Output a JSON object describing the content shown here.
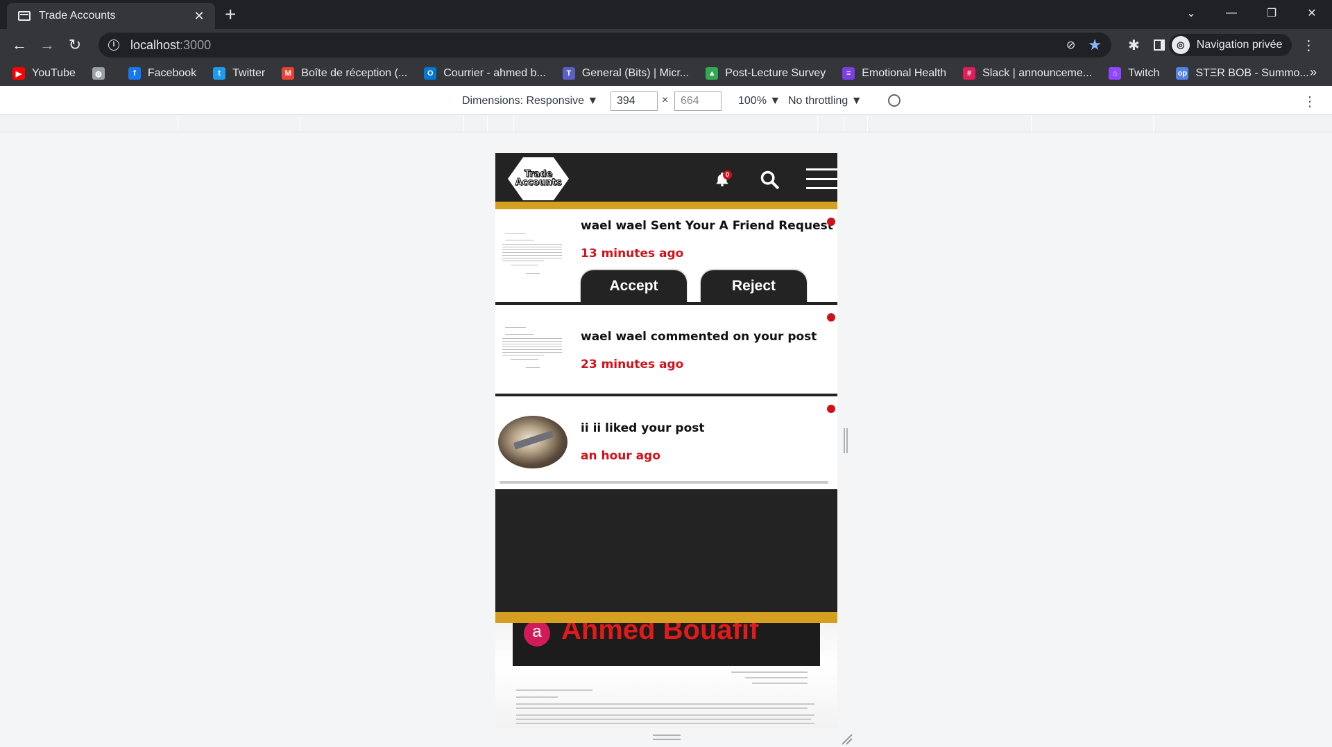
{
  "browser": {
    "tab_title": "Trade Accounts",
    "url_host": "localhost",
    "url_port": ":3000",
    "profile_label": "Navigation privée"
  },
  "bookmarks": [
    {
      "label": "YouTube",
      "icon": "youtube-icon",
      "color": "#ff0000"
    },
    {
      "label": "",
      "icon": "globe-icon",
      "color": "#9aa0a6"
    },
    {
      "label": "Facebook",
      "icon": "facebook-icon",
      "color": "#1877f2"
    },
    {
      "label": "Twitter",
      "icon": "twitter-icon",
      "color": "#1d9bf0"
    },
    {
      "label": "Boîte de réception (...",
      "icon": "gmail-icon",
      "color": "#ea4335"
    },
    {
      "label": "Courrier - ahmed b...",
      "icon": "outlook-icon",
      "color": "#0078d4"
    },
    {
      "label": "General (Bits) | Micr...",
      "icon": "teams-icon",
      "color": "#5b5fc7"
    },
    {
      "label": "Post-Lecture Survey",
      "icon": "drive-icon",
      "color": "#34a853"
    },
    {
      "label": "Emotional Health",
      "icon": "forms-icon",
      "color": "#7b3fe4"
    },
    {
      "label": "Slack | announceme...",
      "icon": "slack-icon",
      "color": "#e01e5a"
    },
    {
      "label": "Twitch",
      "icon": "twitch-icon",
      "color": "#9146ff"
    },
    {
      "label": "STΞR BOB - Summo...",
      "icon": "opgg-icon",
      "color": "#5383e8"
    }
  ],
  "devtools": {
    "dimensions_label": "Dimensions: Responsive ▼",
    "width": "394",
    "height": "664",
    "zoom": "100% ▼",
    "throttling": "No throttling ▼"
  },
  "site": {
    "logo_line1": "Trade",
    "logo_line2": "Accounts",
    "notification_count": "0",
    "notifications": [
      {
        "text": "wael wael Sent Your A Friend Request",
        "time": "13 minutes ago",
        "accept_label": "Accept",
        "reject_label": "Reject"
      },
      {
        "text": "wael wael commented on your post",
        "time": "23 minutes ago"
      },
      {
        "text": "ii ii liked your post",
        "time": "an hour ago"
      }
    ],
    "preview": {
      "avatar_letter": "a",
      "name": "Ahmed Bouafif"
    }
  },
  "colors": {
    "header_bg": "#232323",
    "accent_gold": "#d5a021",
    "accent_red": "#d0111a"
  }
}
